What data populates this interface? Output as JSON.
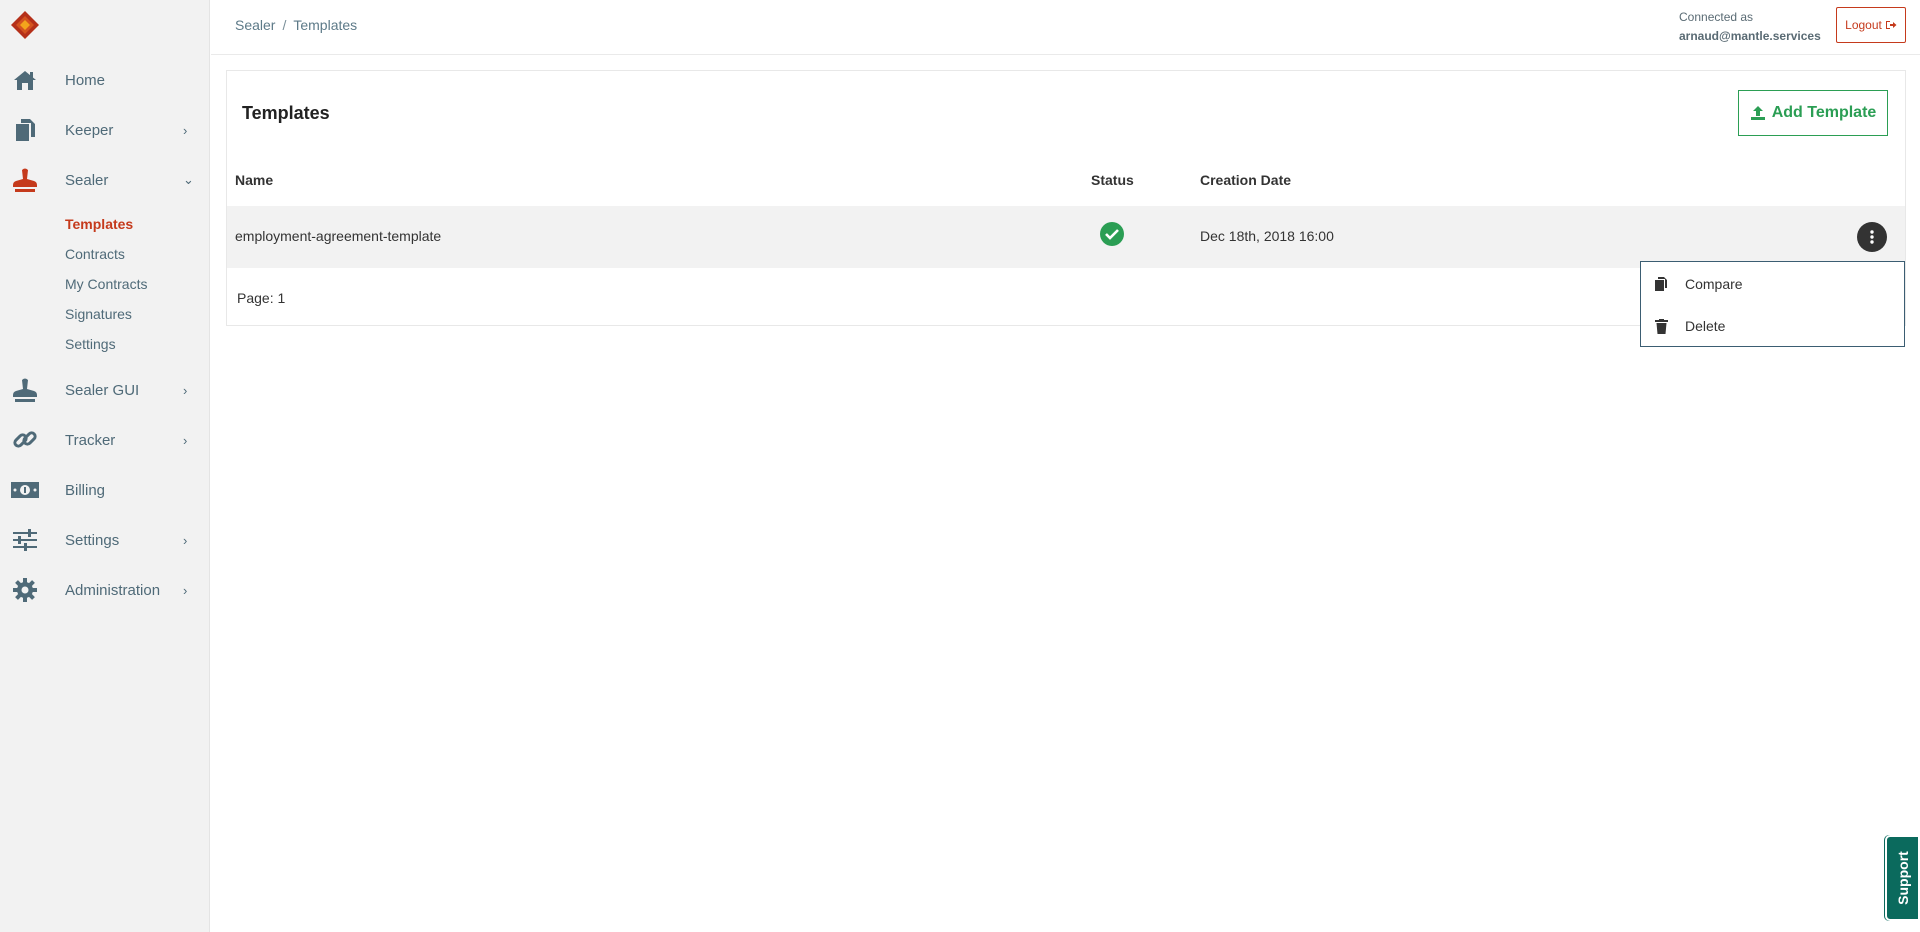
{
  "sidebar": {
    "items": [
      {
        "label": "Home",
        "icon": "home-icon"
      },
      {
        "label": "Keeper",
        "icon": "files-icon"
      },
      {
        "label": "Sealer",
        "icon": "stamp-icon"
      },
      {
        "label": "Sealer GUI",
        "icon": "stamp-icon"
      },
      {
        "label": "Tracker",
        "icon": "link-icon"
      },
      {
        "label": "Billing",
        "icon": "money-icon"
      },
      {
        "label": "Settings",
        "icon": "sliders-icon"
      },
      {
        "label": "Administration",
        "icon": "gear-icon"
      }
    ],
    "sealer_sub": [
      {
        "label": "Templates"
      },
      {
        "label": "Contracts"
      },
      {
        "label": "My Contracts"
      },
      {
        "label": "Signatures"
      },
      {
        "label": "Settings"
      }
    ]
  },
  "header": {
    "breadcrumb": [
      "Sealer",
      "Templates"
    ],
    "connected_label": "Connected as",
    "user": "arnaud@mantle.services",
    "logout_label": "Logout"
  },
  "main": {
    "title": "Templates",
    "add_label": "Add Template",
    "columns": {
      "name": "Name",
      "status": "Status",
      "date": "Creation Date"
    },
    "rows": [
      {
        "name": "employment-agreement-template",
        "status": "ok",
        "date": "Dec 18th, 2018 16:00"
      }
    ],
    "page_label": "Page: 1"
  },
  "menu": {
    "compare_label": "Compare",
    "delete_label": "Delete"
  },
  "support_label": "Support",
  "colors": {
    "accent_red": "#c53a1c",
    "accent_green": "#2b9e54",
    "support_teal": "#0b6a5d",
    "sidebar_text": "#4f6a78"
  }
}
